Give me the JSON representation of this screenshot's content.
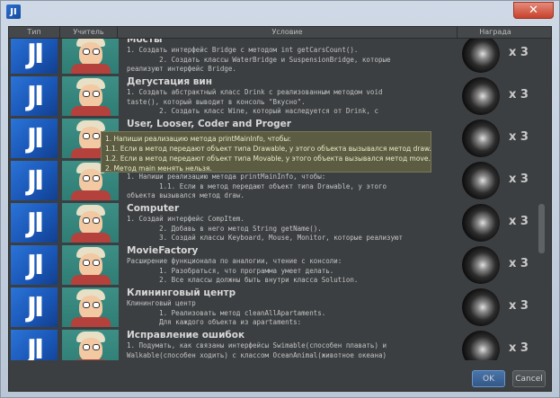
{
  "window": {
    "app_icon_text": "JI",
    "close_label": "✕"
  },
  "table": {
    "columns": [
      "Тип",
      "Учитель",
      "Условие",
      "Награда"
    ],
    "rows": [
      {
        "title": "Мосты",
        "lines": [
          "1. Создать интерфейс Bridge с методом int getCarsCount().",
          "        2. Создать классы WaterBridge и SuspensionBridge, которые",
          "реализуют интерфейс Bridge."
        ],
        "reward": "x 3"
      },
      {
        "title": "Дегустация вин",
        "lines": [
          "1. Создать абстрактный класс Drink с реализованным методом void",
          "taste(), который выводит в консоль \"Вкусно\".",
          "        2. Создать класс Wine, который наследуется от Drink, с"
        ],
        "reward": "x 3"
      },
      {
        "title": "User, Looser, Coder and Proger",
        "lines": [
          "",
          "                                                                  \",",
          ""
        ],
        "reward": "x 3"
      },
      {
        "title": "",
        "lines": [
          "1. Напиши реализацию метода printMainInfo, чтобы:",
          "        1.1. Если в метод передают объект типа Drawable, у этого",
          "объекта вызывался метод draw."
        ],
        "reward": "x 3"
      },
      {
        "title": "Computer",
        "lines": [
          "1. Создай интерфейс CompItem.",
          "        2. Добавь в него метод String getName().",
          "        3. Создай классы Keyboard, Mouse, Monitor, которые реализуют"
        ],
        "reward": "x 3"
      },
      {
        "title": "MovieFactory",
        "lines": [
          "Расширение функционала по аналогии, чтение с консоли:",
          "        1. Разобраться, что программа умеет делать.",
          "        2. Все классы должны быть внутри класса Solution."
        ],
        "reward": "x 3"
      },
      {
        "title": "Клининговый центр",
        "lines": [
          "Клининговый центр",
          "        1. Реализовать метод cleanAllApartaments.",
          "        Для каждого объекта из apartaments:"
        ],
        "reward": "x 3"
      },
      {
        "title": "Исправление ошибок",
        "lines": [
          "1. Подумать, как связаны интерфейсы Swimable(способен плавать) и",
          "Walkable(способен ходить) с классом OceanAnimal(животное океана)",
          ""
        ],
        "reward": "x 3"
      }
    ]
  },
  "tooltip": {
    "lines": [
      "1. Напиши реализацию метода printMainInfo, чтобы:",
      "1.1. Если в метод передают объект типа Drawable, у этого объекта вызывался метод draw.",
      "1.2. Если в метод передают объект типа Movable, у этого объекта вызывался метод move.",
      "2. Метод main менять нельзя."
    ]
  },
  "buttons": {
    "ok": "OK",
    "cancel": "Cancel"
  }
}
